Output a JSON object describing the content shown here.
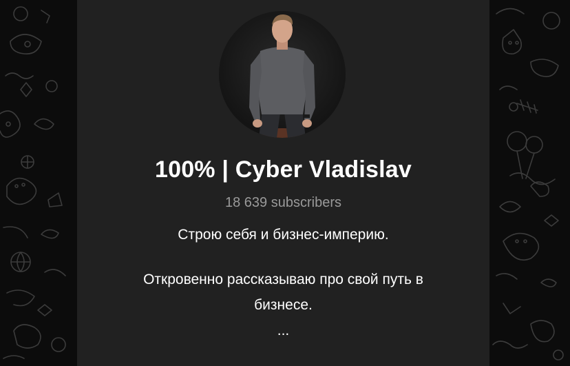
{
  "channel": {
    "title": "100% | Cyber Vladislav",
    "subscribers": "18 639 subscribers",
    "description": {
      "line1": "Строю себя и бизнес-империю.",
      "line2": "Откровенно рассказываю про свой путь в",
      "line3": "бизнесе.",
      "line4": "..."
    }
  },
  "avatar": {
    "icon": "person-photo"
  },
  "colors": {
    "background": "#0c0c0c",
    "card": "#212121",
    "title": "#ffffff",
    "subscribers": "#9a9a9a",
    "pattern": "#3a3a3a"
  }
}
